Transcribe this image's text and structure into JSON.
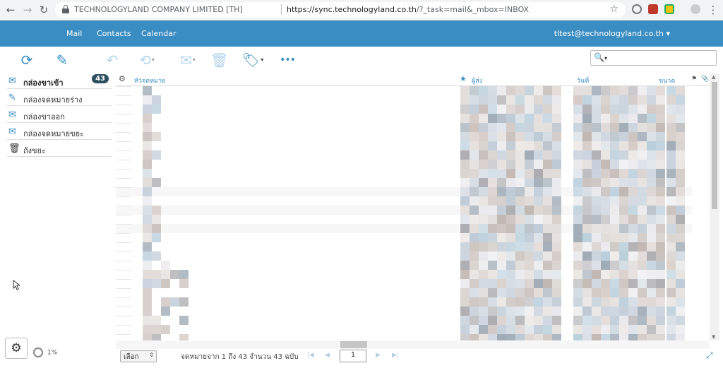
{
  "browser": {
    "back": "←",
    "forward": "→",
    "reload": "↻",
    "site_name": "TECHNOLOGYLAND COMPANY LIMITED [TH]",
    "url_host": "https://sync.technologyland.co.th",
    "url_path": "/?_task=mail&_mbox=INBOX",
    "star": "☆",
    "menu": "⋮"
  },
  "header": {
    "nav": [
      "Mail",
      "Contacts",
      "Calendar"
    ],
    "user": "tltest@technologyland.co.th ▾"
  },
  "toolbar": {
    "refresh": "⟳",
    "compose": "✎",
    "reply": "↶",
    "reply_all": "⟲",
    "forward": "✉",
    "delete": "🗑",
    "tag": "🏷",
    "more": "•••",
    "search_icon": "🔍",
    "search_caret": "▾",
    "search_value": ""
  },
  "folders": [
    {
      "name": "กล่องขาเข้า",
      "icon": "inbox-icon",
      "glyph": "✉",
      "count": "43",
      "selected": true
    },
    {
      "name": "กล่องจดหมายร่าง",
      "icon": "pencil-icon",
      "glyph": "✎",
      "count": "",
      "selected": false
    },
    {
      "name": "กล่องขาออก",
      "icon": "outbox-icon",
      "glyph": "✉",
      "count": "",
      "selected": false
    },
    {
      "name": "กล่องจดหมายขยะ",
      "icon": "junk-icon",
      "glyph": "✉",
      "count": "",
      "selected": false
    },
    {
      "name": "ถังขยะ",
      "icon": "trash-icon",
      "glyph": "🗑",
      "count": "",
      "selected": false
    }
  ],
  "list": {
    "col_settings": "⚙",
    "col_subject": "หัวจดหมาย",
    "col_star": "★",
    "col_from": "ผู้ส่ง",
    "col_date": "วันที่",
    "col_size": "ขนาด",
    "col_flag": "⚑",
    "col_attach": "📎"
  },
  "footer": {
    "settings": "⚙",
    "quota": "1%",
    "select": "เลือก",
    "count_text": "จดหมายจาก 1 ถึง 43 จำนวน 43 ฉบับ",
    "first": "|◀",
    "prev": "◀",
    "page": "1",
    "next": "▶",
    "last": "▶|",
    "expand": "⤢"
  },
  "colors": {
    "accent": "#3a8dc2",
    "badge": "#2b4f5e"
  }
}
